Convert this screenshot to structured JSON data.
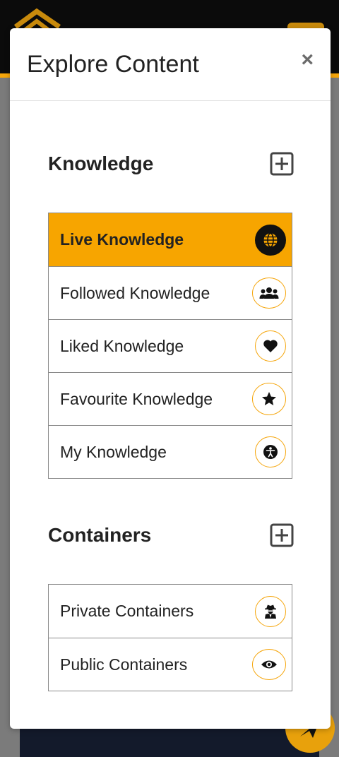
{
  "modal": {
    "title": "Explore Content",
    "close_label": "×"
  },
  "knowledge": {
    "title": "Knowledge",
    "items": [
      {
        "label": "Live Knowledge",
        "icon": "globe-icon",
        "active": true
      },
      {
        "label": "Followed Knowledge",
        "icon": "users-icon",
        "active": false
      },
      {
        "label": "Liked Knowledge",
        "icon": "heart-icon",
        "active": false
      },
      {
        "label": "Favourite Knowledge",
        "icon": "star-icon",
        "active": false
      },
      {
        "label": "My Knowledge",
        "icon": "accessibility-icon",
        "active": false
      }
    ]
  },
  "containers": {
    "title": "Containers",
    "items": [
      {
        "label": "Private Containers",
        "icon": "user-secret-icon"
      },
      {
        "label": "Public Containers",
        "icon": "eye-icon"
      }
    ]
  },
  "colors": {
    "accent": "#f7a500",
    "header_bg": "#0b0b0b",
    "text": "#222222"
  }
}
